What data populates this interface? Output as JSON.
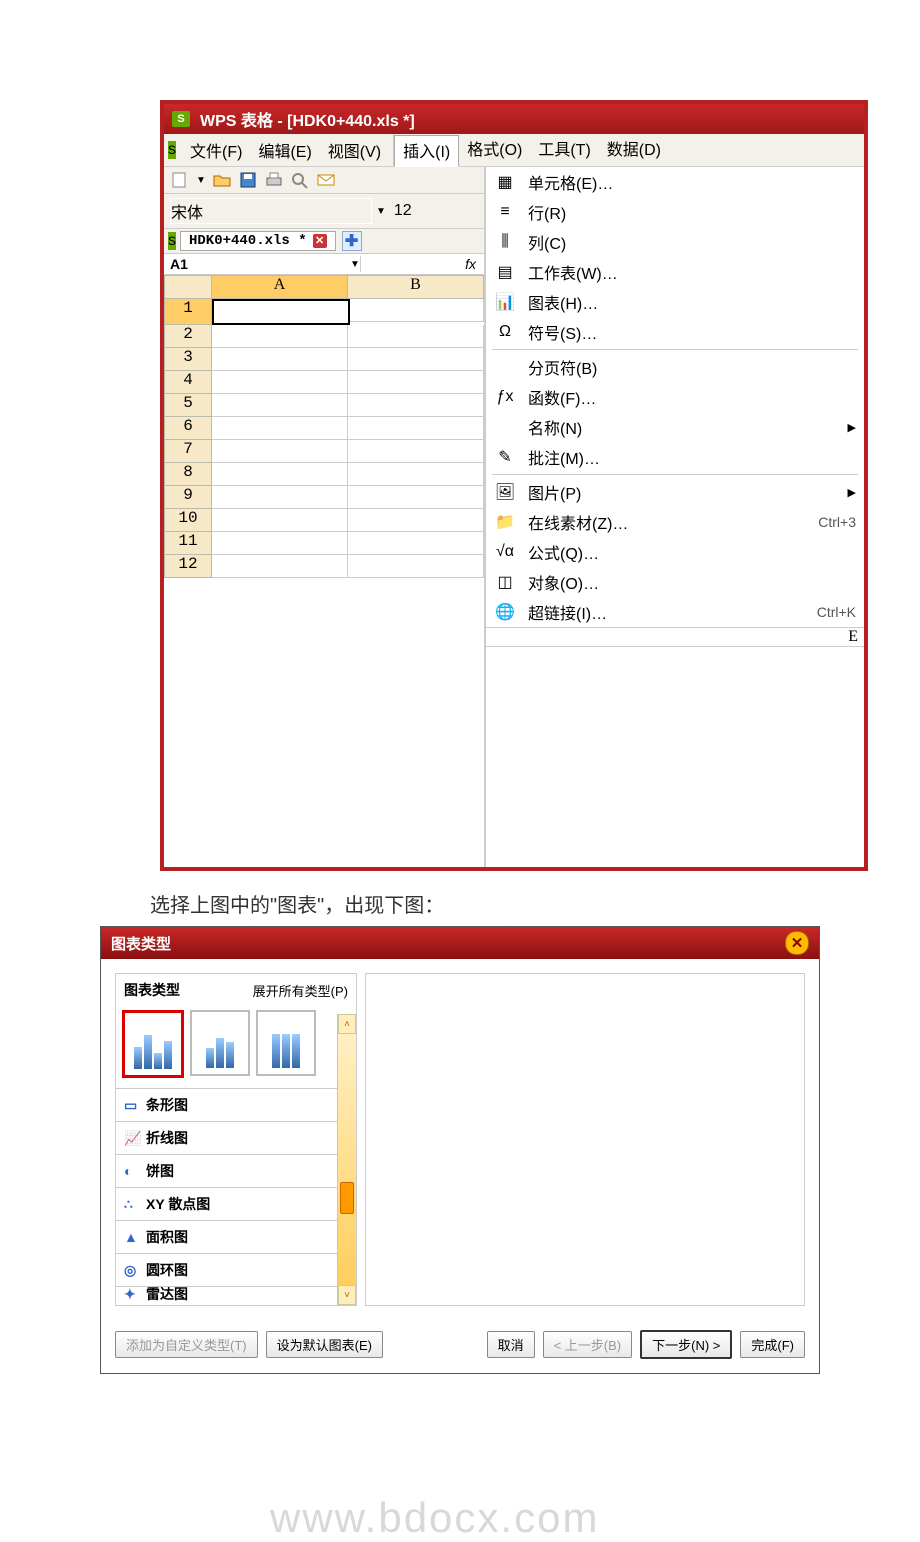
{
  "window": {
    "title": "WPS 表格 - [HDK0+440.xls *]",
    "app_badge": "S"
  },
  "menu": {
    "file": "文件(F)",
    "edit": "编辑(E)",
    "view": "视图(V)",
    "insert": "插入(I)",
    "format": "格式(O)",
    "tools": "工具(T)",
    "data": "数据(D)"
  },
  "font": {
    "name": "宋体",
    "size": "12"
  },
  "tab": {
    "label": "HDK0+440.xls *"
  },
  "cellref": "A1",
  "columns": [
    "A",
    "B"
  ],
  "far_col": "E",
  "rows": [
    "1",
    "2",
    "3",
    "4",
    "5",
    "6",
    "7",
    "8",
    "9",
    "10",
    "11",
    "12"
  ],
  "insert_menu": [
    {
      "label": "单元格(E)…",
      "icon": "cells-icon"
    },
    {
      "label": "行(R)",
      "icon": "row-icon"
    },
    {
      "label": "列(C)",
      "icon": "column-icon"
    },
    {
      "label": "工作表(W)…",
      "icon": "sheet-icon"
    },
    {
      "label": "图表(H)…",
      "icon": "chart-icon"
    },
    {
      "label": "符号(S)…",
      "icon": "omega-icon"
    },
    {
      "sep": true
    },
    {
      "label": "分页符(B)",
      "icon": ""
    },
    {
      "label": "函数(F)…",
      "icon": "fx-icon"
    },
    {
      "label": "名称(N)",
      "icon": "",
      "sub": true
    },
    {
      "label": "批注(M)…",
      "icon": "comment-icon"
    },
    {
      "sep": true
    },
    {
      "label": "图片(P)",
      "icon": "picture-icon",
      "sub": true
    },
    {
      "label": "在线素材(Z)…",
      "icon": "online-icon",
      "shortcut": "Ctrl+3"
    },
    {
      "label": "公式(Q)…",
      "icon": "sqrt-icon"
    },
    {
      "label": "对象(O)…",
      "icon": "object-icon"
    },
    {
      "label": "超链接(I)…",
      "icon": "globe-icon",
      "shortcut": "Ctrl+K"
    }
  ],
  "caption": "选择上图中的\"图表\"，出现下图：",
  "dialog": {
    "title": "图表类型",
    "panel_title": "图表类型",
    "expand": "展开所有类型(P)",
    "categories": [
      {
        "label": "条形图"
      },
      {
        "label": "折线图"
      },
      {
        "label": "饼图"
      },
      {
        "label": "XY 散点图"
      },
      {
        "label": "面积图"
      },
      {
        "label": "圆环图"
      },
      {
        "label": "雷达图"
      }
    ],
    "buttons": {
      "add_custom": "添加为自定义类型(T)",
      "set_default": "设为默认图表(E)",
      "cancel": "取消",
      "back": "< 上一步(B)",
      "next": "下一步(N) >",
      "finish": "完成(F)"
    }
  }
}
